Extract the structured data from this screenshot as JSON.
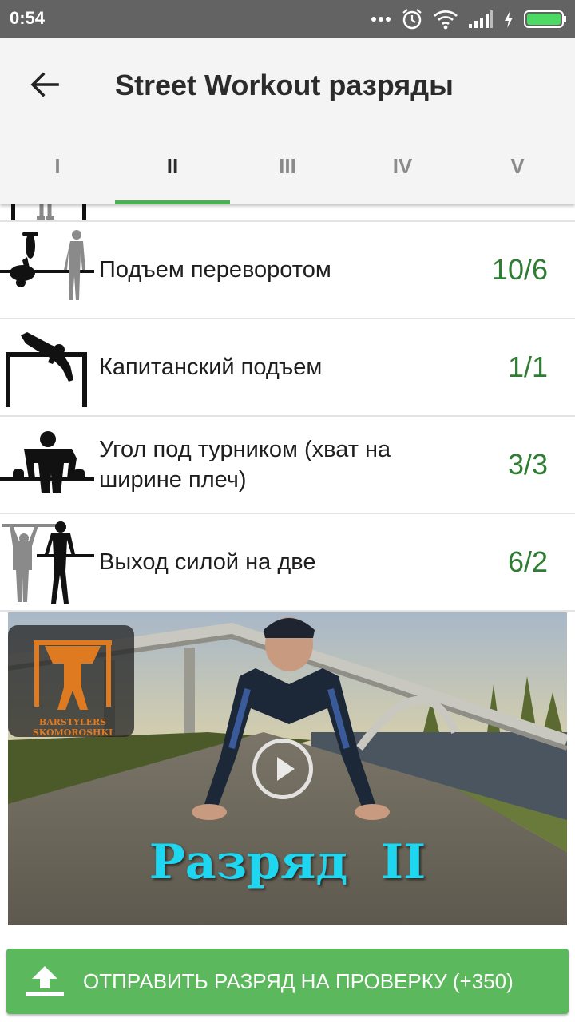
{
  "status_bar": {
    "time": "0:54"
  },
  "toolbar": {
    "title": "Street Workout разряды"
  },
  "tabs": [
    {
      "label": "I",
      "active": false
    },
    {
      "label": "II",
      "active": true
    },
    {
      "label": "III",
      "active": false
    },
    {
      "label": "IV",
      "active": false
    },
    {
      "label": "V",
      "active": false
    }
  ],
  "exercises": [
    {
      "name": "Подъем переворотом",
      "value": "10/6",
      "icon": "muscle-up-roll-icon"
    },
    {
      "name": "Капитанский подъем",
      "value": "1/1",
      "icon": "captain-lift-icon"
    },
    {
      "name": "Угол под турником (хват на ширине плеч)",
      "value": "3/3",
      "icon": "l-sit-bar-icon"
    },
    {
      "name": "Выход силой на две",
      "value": "6/2",
      "icon": "muscle-up-two-arms-icon"
    }
  ],
  "video": {
    "logo_text_line1": "BARSTYLERS",
    "logo_text_line2": "SKOMOROSHKI",
    "caption": "Разряд  II"
  },
  "submit_button": {
    "label": "ОТПРАВИТЬ РАЗРЯД НА ПРОВЕРКУ (+350)"
  },
  "colors": {
    "accent": "#4caf50",
    "value_green": "#2e7d32",
    "button": "#5cb85c",
    "caption": "#1fd6f0"
  }
}
